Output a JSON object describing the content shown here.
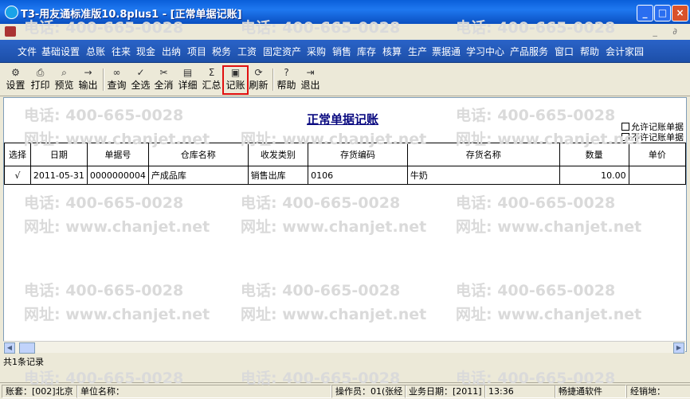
{
  "window": {
    "title": "T3-用友通标准版10.8plus1 - [正常单据记账]"
  },
  "menu": [
    "文件",
    "基础设置",
    "总账",
    "往来",
    "现金",
    "出纳",
    "项目",
    "税务",
    "工资",
    "固定资产",
    "采购",
    "销售",
    "库存",
    "核算",
    "生产",
    "票据通",
    "学习中心",
    "产品服务",
    "窗口",
    "帮助",
    "会计家园"
  ],
  "toolbar": {
    "set": "设置",
    "print": "打印",
    "preview": "预览",
    "export": "输出",
    "query": "查询",
    "select_all": "全选",
    "deselect_all": "全消",
    "detail": "详细",
    "summary": "汇总",
    "post": "记账",
    "refresh": "刷新",
    "help": "帮助",
    "exit": "退出"
  },
  "page": {
    "title": "正常单据记账",
    "filter_allow": "允许记账单据",
    "filter_disallow": "不许记账单据"
  },
  "table": {
    "headers": [
      "选择",
      "日期",
      "单据号",
      "仓库名称",
      "收发类别",
      "存货编码",
      "存货名称",
      "数量",
      "单价"
    ],
    "rows": [
      [
        "√",
        "2011-05-31",
        "0000000004",
        "产成品库",
        "销售出库",
        "0106",
        "牛奶",
        "10.00",
        ""
      ]
    ]
  },
  "record_count": "共1条记录",
  "status": {
    "account_set": "账套：[002]北京",
    "company": "单位名称：",
    "operator": "操作员：01(张经",
    "business_date": "业务日期：[2011]",
    "time": "13:36",
    "product": "畅捷通软件",
    "dealer": "经销地："
  },
  "watermark": {
    "phone": "电话: 400-665-0028",
    "web": "网址: www.chanjet.net"
  }
}
